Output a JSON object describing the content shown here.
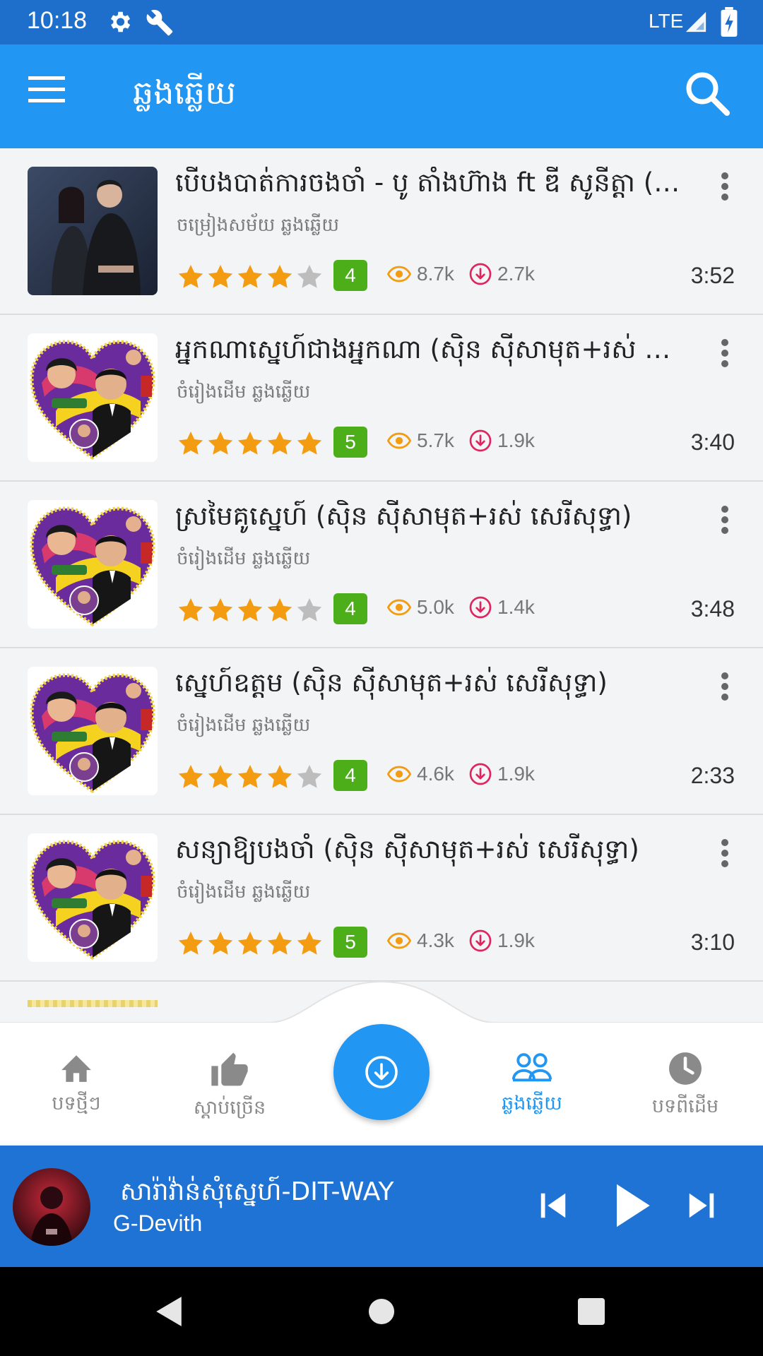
{
  "status_bar": {
    "time": "10:18",
    "network": "LTE"
  },
  "app_bar": {
    "title": "ឆ្លងឆ្លើយ"
  },
  "songs": [
    {
      "title": "បើបងបាត់ការចងចាំ -  បូ តាំងហ៊ាង ft ឌី សូនីត្តា (ភ្លេងសុទ្ធ)",
      "subtitle": "ចម្រៀងសម័យ ឆ្លងឆ្លើយ",
      "rating": 4,
      "rating_label": "4",
      "views": "8.7k",
      "downloads": "2.7k",
      "duration": "3:52",
      "thumb": "modern-couple"
    },
    {
      "title": "អ្នកណាស្នេហ៍ជាងអ្នកណា (ស៊ិន ស៊ីសាមុត+រស់ សេរីសុទ្ធា)",
      "subtitle": "ចំរៀងដើម ឆ្លងឆ្លើយ",
      "rating": 5,
      "rating_label": "5",
      "views": "5.7k",
      "downloads": "1.9k",
      "duration": "3:40",
      "thumb": "classic-heart"
    },
    {
      "title": "ស្រមៃគូស្នេហ៍ (ស៊ិន ស៊ីសាមុត+រស់ សេរីសុទ្ធា)",
      "subtitle": "ចំរៀងដើម ឆ្លងឆ្លើយ",
      "rating": 4,
      "rating_label": "4",
      "views": "5.0k",
      "downloads": "1.4k",
      "duration": "3:48",
      "thumb": "classic-heart"
    },
    {
      "title": "ស្នេហ៍ឧត្តម (ស៊ិន ស៊ីសាមុត+រស់ សេរីសុទ្ធា)",
      "subtitle": "ចំរៀងដើម ឆ្លងឆ្លើយ",
      "rating": 4,
      "rating_label": "4",
      "views": "4.6k",
      "downloads": "1.9k",
      "duration": "2:33",
      "thumb": "classic-heart"
    },
    {
      "title": "សន្យាឱ្យបងចាំ (ស៊ិន ស៊ីសាមុត+រស់ សេរីសុទ្ធា)",
      "subtitle": "ចំរៀងដើម ឆ្លងឆ្លើយ",
      "rating": 5,
      "rating_label": "5",
      "views": "4.3k",
      "downloads": "1.9k",
      "duration": "3:10",
      "thumb": "classic-heart"
    }
  ],
  "bottom_nav": {
    "items": [
      {
        "label": "បទថ្មីៗ",
        "icon": "home-icon"
      },
      {
        "label": "ស្តាប់ច្រើន",
        "icon": "thumbs-up-icon"
      },
      {
        "label": "ឆ្លងឆ្លើយ",
        "icon": "people-icon"
      },
      {
        "label": "បទពីដើម",
        "icon": "clock-icon"
      }
    ],
    "fab_icon": "download-icon",
    "active_index": 2
  },
  "player": {
    "track_title": "សារ៉ាវ៉ាន់សុំស្នេហ៍-DIT-WAY",
    "artist": "G-Devith"
  },
  "colors": {
    "primary": "#2196f3",
    "status_bar": "#1e6fcc",
    "player": "#1f73d4",
    "star": "#f39c12",
    "star_empty": "#bdbdbd",
    "badge": "#4caf1a",
    "eye": "#f39c12",
    "download": "#e0245e"
  }
}
